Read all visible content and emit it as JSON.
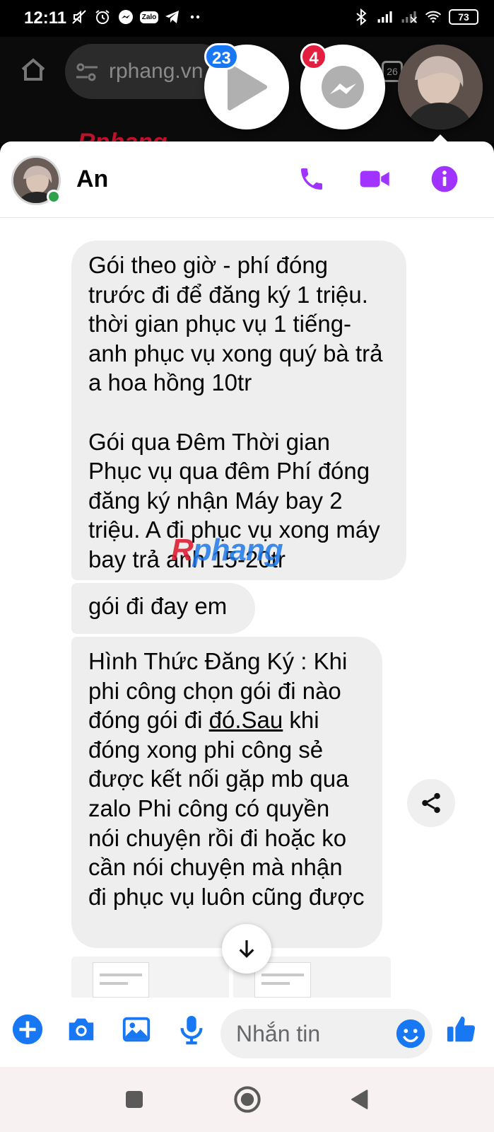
{
  "status_bar": {
    "time": "12:11",
    "zalo_label": "Zalo",
    "battery": "73",
    "left_icons": [
      "mute-icon",
      "alarm-icon",
      "messenger-notif-icon",
      "zalo-icon",
      "telegram-icon",
      "more-dots-icon"
    ],
    "right_icons": [
      "bluetooth-icon",
      "signal-icon",
      "signal-no-service-icon",
      "wifi-icon",
      "battery-icon"
    ]
  },
  "browser": {
    "url": "rphang.vn",
    "tab_count": "26",
    "site_logo": "Rphang"
  },
  "chat_heads": {
    "video_badge": "23",
    "messenger_badge": "4"
  },
  "chat": {
    "contact_name": "An",
    "online": true,
    "accent_color": "#a033ff",
    "messages": [
      "Gói theo giờ - phí đóng trước đi để đăng ký 1 triệu. thời gian phục vụ 1 tiếng- anh phục vụ xong quý bà trả a hoa hồng 10tr\n\nGói qua Đêm  Thời gian Phục vụ qua đêm Phí đóng đăng ký nhận Máy bay 2 triệu. A đi phục vụ xong máy bay trả anh 15-20tr",
      "gói đi đay em",
      {
        "before_link": "Hình Thức Đăng Ký : Khi phi công chọn gói đi nào đóng gói đi ",
        "link": "đó.Sau",
        "after_link": " khi đóng xong phi công sẻ được kết nối gặp mb qua zalo  Phi công có quyền nói chuyện rồi đi hoặc ko cần nói chuyện mà nhận đi phục vụ luôn cũng được"
      }
    ],
    "watermark_r": "R",
    "watermark_rest": "phang"
  },
  "composer": {
    "placeholder": "Nhắn tin",
    "accent_color": "#1877f2"
  }
}
